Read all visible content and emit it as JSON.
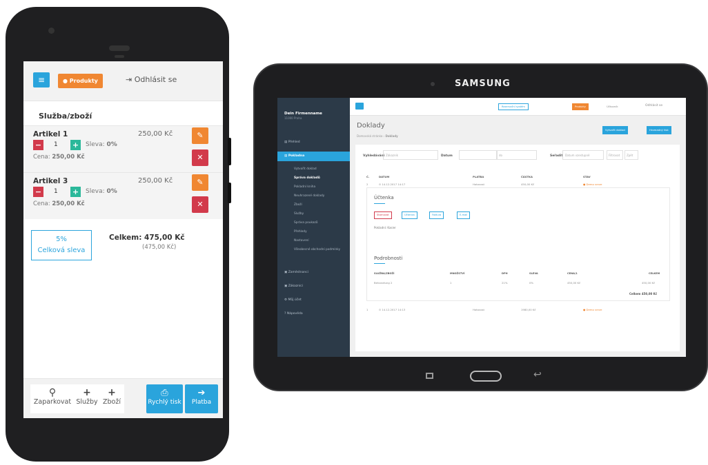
{
  "phone": {
    "header": {
      "menu_icon": "hamburger-icon",
      "products_label": "Produkty",
      "logout_label": "Odhlásit se"
    },
    "section_title": "Služba/zboží",
    "items": [
      {
        "name": "Artikel 1",
        "price": "250,00 Kč",
        "qty": "1",
        "discount_label": "Sleva:",
        "discount": "0%",
        "unit_label": "Cena:",
        "unit_price": "250,00 Kč"
      },
      {
        "name": "Artikel 3",
        "price": "250,00 Kč",
        "qty": "1",
        "discount_label": "Sleva:",
        "discount": "0%",
        "unit_label": "Cena:",
        "unit_price": "250,00 Kč"
      }
    ],
    "discount_box": {
      "percent": "5%",
      "label": "Celková sleva"
    },
    "total": {
      "label": "Celkem: 475,00 Kč",
      "sub": "(475,00 Kč)"
    },
    "footer": {
      "park": "Zaparkovat",
      "services": "Služby",
      "goods": "Zboží",
      "print": "Rychlý tisk",
      "pay": "Platba"
    }
  },
  "tablet": {
    "brand": "SAMSUNG",
    "sidebar": {
      "company": "Dein Firmenname",
      "company_sub": "11000 Praha",
      "items": [
        {
          "label": "Přehled"
        },
        {
          "label": "Pokladna"
        },
        {
          "label": "Zaměstnanci"
        },
        {
          "label": "Zákazníci"
        },
        {
          "label": "Můj účet"
        },
        {
          "label": "Nápověda"
        }
      ],
      "subitems": [
        "Vytvořit doklad",
        "Správa dokladů",
        "Pokladní kniha",
        "Neuhrazené doklady",
        "Zboží",
        "Služby",
        "Správa poukazů",
        "Přehledy",
        "Nastavení",
        "Všeobecné obchodní podmínky"
      ]
    },
    "topbar": {
      "register_label": "Rezervační systém",
      "products_label": "Produkty",
      "user_label": "Účtovník",
      "logout_label": "Odhlásit se"
    },
    "page": {
      "title": "Doklady",
      "breadcrumb_home": "Domovská stránka",
      "breadcrumb_current": "Doklady",
      "create_btn": "Vytvořit doklad",
      "print_btn": "Hromadný tisk"
    },
    "filters": {
      "search_label": "Vyhledávání",
      "search_placeholder": "Zákazník",
      "date_label": "Datum",
      "date_to": "do",
      "sort_label": "Seřadit",
      "sort_value": "Datum vzestupně",
      "filter_btn": "Filtrovat",
      "reset_btn": "Zpět"
    },
    "table": {
      "headers": [
        "Č.",
        "DATUM",
        "PLATBA",
        "ČÁSTKA",
        "STAV"
      ],
      "rows": [
        {
          "no": "2",
          "date": "14.12.2017",
          "time": "14:17",
          "payment": "Hotovost",
          "amount": "450,00 Kč",
          "status": "Demo verze"
        },
        {
          "no": "1",
          "date": "14.12.2017",
          "time": "14:13",
          "payment": "Hotovost",
          "amount": "1980,00 Kč",
          "status": "Demo verze"
        }
      ]
    },
    "detail": {
      "account_title": "Účtenka",
      "actions": [
        "Stornovat",
        "Účtenka",
        "Faktura",
        "E-mail"
      ],
      "cashier": "Pokladní: Kasier",
      "details_title": "Podrobnosti",
      "headers": [
        "SLUŽBA/ZBOŽÍ",
        "MNOŽSTVÍ",
        "DPH",
        "SLEVA",
        "CENA/1",
        "CELKEM"
      ],
      "row": [
        "Behandlung 2",
        "1",
        "21%",
        "0%",
        "450,00 Kč",
        "450,00 Kč"
      ],
      "total": "Celkem 450,00 Kč"
    }
  }
}
